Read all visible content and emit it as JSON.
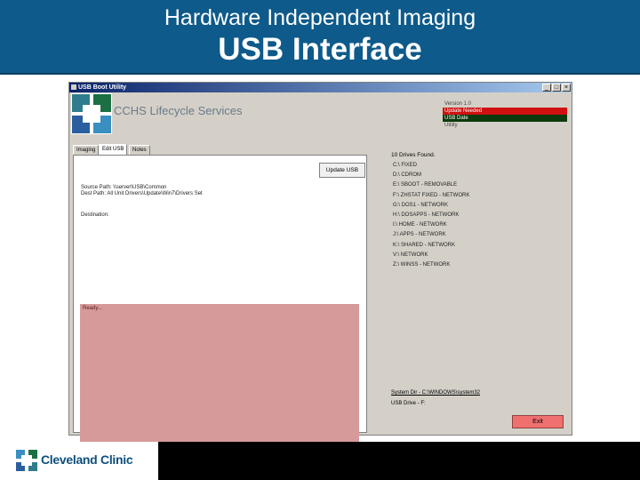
{
  "slide": {
    "title": "Hardware Independent Imaging",
    "subtitle": "USB Interface",
    "footer_brand": "Cleveland Clinic"
  },
  "window": {
    "title": "USB Boot Utility",
    "controls": [
      "_",
      "□",
      "×"
    ],
    "app_name": "CCHS Lifecycle Services",
    "status": [
      {
        "text": "Version  1.0",
        "style": "plain"
      },
      {
        "text": "Update Needed",
        "style": "red"
      },
      {
        "text": "USB Date",
        "style": "green"
      },
      {
        "text": "Utility",
        "style": "plain"
      }
    ],
    "tabs": [
      "Imaging",
      "Edit USB",
      "Notes"
    ],
    "active_tab": 1,
    "update_button": "Update USB",
    "source_path_lines": [
      "Source Path: \\\\server\\USB\\Common",
      "Dest Path: All Unit Drivers\\Update\\Win7\\Drivers Set"
    ],
    "destination_label": "Destination:",
    "log_text": "Ready...",
    "drives_header": "10 Drives Found.",
    "drives": [
      "C:\\ FIXED",
      "D:\\ CDROM",
      "E:\\ SBOOT - REMOVABLE",
      "F:\\ ZHSTAT FIXED - NETWORK",
      "G:\\ DOS1 - NETWORK",
      "H:\\ DOSAPPS - NETWORK",
      "I:\\ HOME - NETWORK",
      "J:\\ APPS - NETWORK",
      "K:\\ SHARED - NETWORK",
      "V:\\ NETWORK",
      "Z:\\ WINSS - NETWORK"
    ],
    "system_dir": "System Dir - C:\\WINDOWS\\system32",
    "usb_drive": "USB Drive - F:",
    "exit_button": "Exit"
  },
  "colors": {
    "header_bg": "#0e5a8a",
    "log_bg": "#d79a9a",
    "exit_bg": "#f07070",
    "status_red": "#d01010",
    "status_green": "#0c3a0c"
  }
}
